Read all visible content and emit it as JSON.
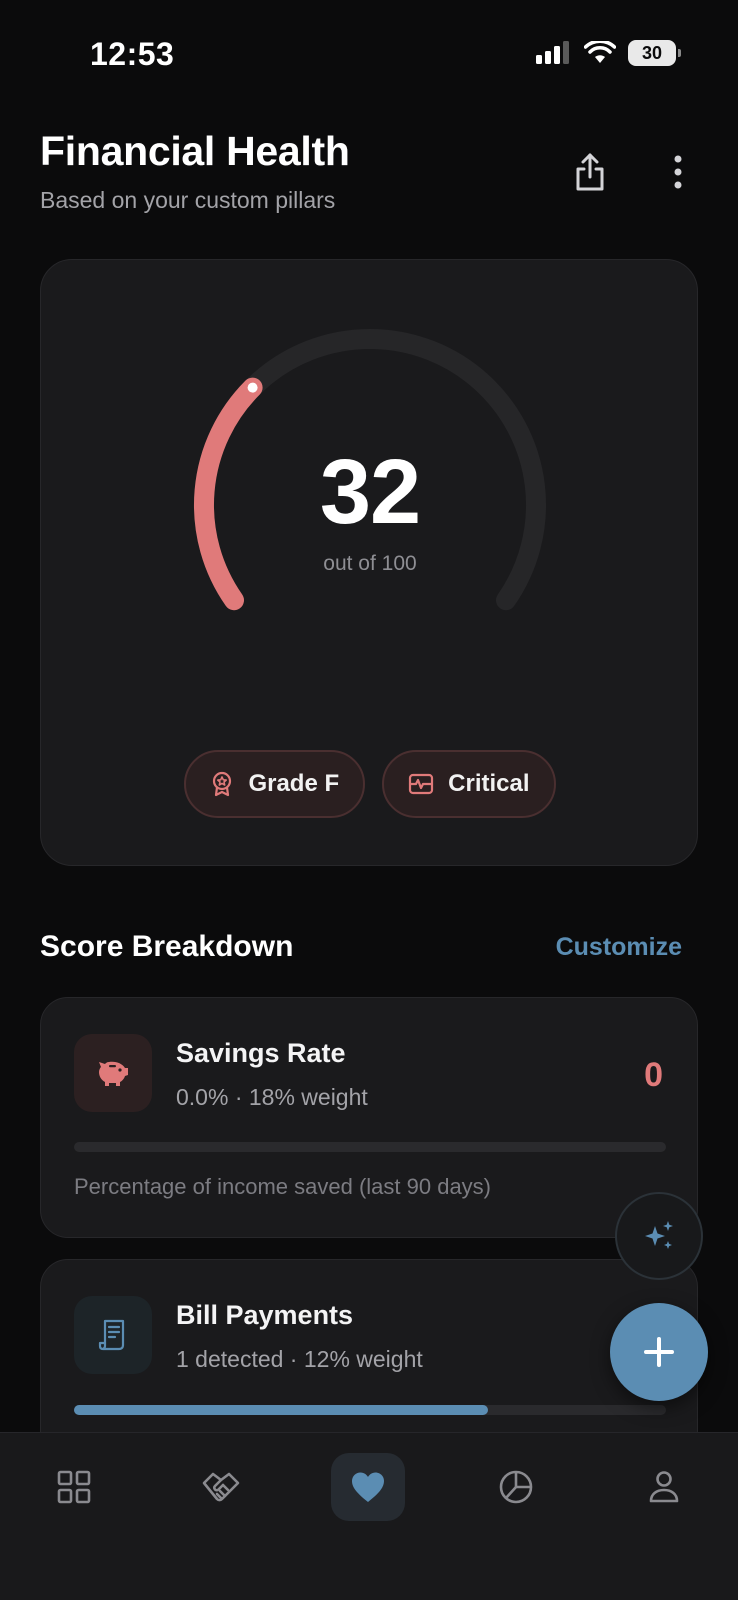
{
  "status_bar": {
    "time": "12:53",
    "battery": "30"
  },
  "header": {
    "title": "Financial Health",
    "subtitle": "Based on your custom pillars",
    "share_icon": "share-icon",
    "more_icon": "more-vertical-icon"
  },
  "score": {
    "value": "32",
    "max_label": "out of 100",
    "fraction": 0.32,
    "grade_label": "Grade F",
    "status_label": "Critical",
    "arc_color": "#e07a7a"
  },
  "breakdown": {
    "title": "Score Breakdown",
    "customize_label": "Customize",
    "pillars": [
      {
        "name": "Savings Rate",
        "meta": "0.0% · 18% weight",
        "score": "0",
        "progress": 0,
        "description": "Percentage of income saved (last 90 days)",
        "icon": "piggy-bank-icon"
      },
      {
        "name": "Bill Payments",
        "meta": "1 detected · 12% weight",
        "score": "",
        "progress": 0.7,
        "description": "",
        "icon": "receipt-icon"
      }
    ]
  },
  "nav": {
    "items": [
      {
        "icon": "grid-icon",
        "active": false
      },
      {
        "icon": "handshake-icon",
        "active": false
      },
      {
        "icon": "heart-icon",
        "active": true
      },
      {
        "icon": "pie-chart-icon",
        "active": false
      },
      {
        "icon": "user-icon",
        "active": false
      }
    ]
  },
  "colors": {
    "accent": "#5b8db3",
    "critical": "#e07a7a",
    "card": "#1a1a1c"
  }
}
